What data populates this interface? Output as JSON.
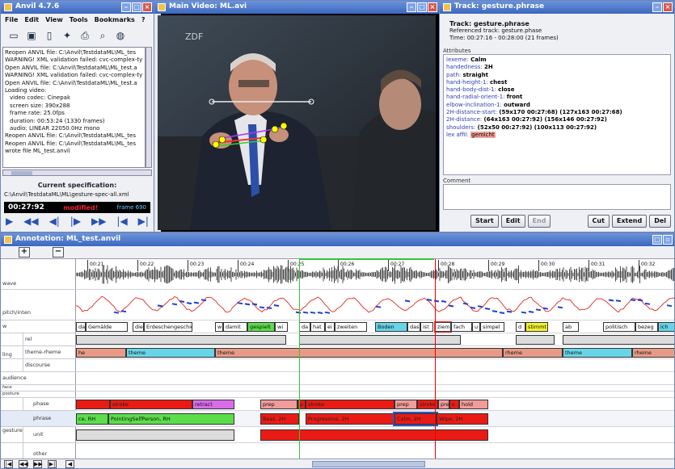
{
  "anvil": {
    "title": "Anvil 4.7.6",
    "menu": [
      "File",
      "Edit",
      "View",
      "Tools",
      "Bookmarks",
      "?"
    ],
    "log": [
      "Reopen ANVIL file: C:\\Anvil\\TestdataML\\ML_tes",
      "WARNING! XML validation failed: cvc-complex-ty",
      "Open ANVIL file: C:\\Anvil\\TestdataML\\ML_test.a",
      "WARNING! XML validation failed: cvc-complex-ty",
      "Open ANVIL file: C:\\Anvil\\TestdataML\\ML_test.a",
      "Loading video:",
      "  video codec: Cinepak",
      "  screen size: 390x288",
      "  frame rate: 25.0fps",
      "  duration: 00:53:24 (1330 frames)",
      "  audio: LINEAR 22050.0Hz mono",
      "Reopen ANVIL file: C:\\Anvil\\TestdataML\\ML_tes",
      "Reopen ANVIL file: C:\\Anvil\\TestdataML\\ML_tes",
      "wrote file ML_test.anvil"
    ],
    "spec_label": "Current specification:",
    "spec_path": "C:\\Anvil\\TestdataML\\ML\\gesture-spec-all.xml",
    "time": "00:27:92",
    "modified": "modified!",
    "frame": "frame 690"
  },
  "video": {
    "title": "Main Video: ML.avi",
    "logo": "ZDF"
  },
  "track": {
    "title": "Track: gesture.phrase",
    "name": "Track: gesture.phrase",
    "ref": "Referenced track: gesture.phase",
    "time": "Time: 00:27:16 - 00:28:00 (21 frames)",
    "attributes_label": "Attributes",
    "attributes": [
      {
        "k": "lexeme:",
        "v": "Calm"
      },
      {
        "k": "handedness:",
        "v": "2H"
      },
      {
        "k": "path:",
        "v": "straight"
      },
      {
        "k": "hand-height-1:",
        "v": "chest"
      },
      {
        "k": "hand-body-dist-1:",
        "v": "close"
      },
      {
        "k": "hand-radial-orient-1:",
        "v": "front"
      },
      {
        "k": "elbow-inclination-1:",
        "v": "outward"
      },
      {
        "k": "2H-distance-start:",
        "v": "(59x170 00:27:68) (127x163 00:27:68)"
      },
      {
        "k": "2H-distance:",
        "v": "(64x163 00:27:92) (156x146 00:27:92)"
      },
      {
        "k": "shoulders:",
        "v": "(52x50 00:27:92) (100x113 00:27:92)"
      }
    ],
    "lex_label": "lex affil:",
    "lex_value": "gemicht",
    "comment_label": "Comment",
    "buttons": {
      "start": "Start",
      "edit": "Edit",
      "end": "End",
      "cut": "Cut",
      "extend": "Extend",
      "del": "Del"
    }
  },
  "annotation": {
    "title": "Annotation: ML_test.anvil",
    "ticks": [
      "00:21",
      "00:22",
      "00:23",
      "00:24",
      "00:25",
      "00:26",
      "00:27",
      "00:28",
      "00:29",
      "00:30",
      "00:31",
      "00:32"
    ],
    "rows": {
      "wave": "wave",
      "pitch": "pitch/inten",
      "w": "w",
      "rel": "rel",
      "ling": "ling",
      "theme": "theme-rheme",
      "discourse": "discourse",
      "audience": "audience",
      "face": "face",
      "posture": "posture",
      "gesture": "gesture",
      "phase": "phase",
      "phrase": "phrase",
      "unit": "unit",
      "other": "other"
    },
    "words": [
      "das",
      "Gemälde",
      "die",
      "Erdeschengeschic",
      "w",
      "damit",
      "gespielt",
      "wi",
      "da",
      "hat",
      "ei",
      "zweiten",
      "Boden",
      "das",
      "ist",
      "ziemi",
      "fach",
      "u",
      "simpel",
      "d",
      "stimmt",
      "ab",
      "politisch",
      "bezeg",
      "ich"
    ],
    "themes": [
      "he",
      "theme",
      "theme",
      "rheme",
      "theme",
      "rheme"
    ],
    "phases": [
      "stroke",
      "retract",
      "prep",
      "p",
      "stroke",
      "prep",
      "stroke",
      "pre",
      "s",
      "hold"
    ],
    "phrases": [
      "ce, RH",
      "PointingSelfPerson, RH",
      "Beat, 2H",
      "Progressive, 2H",
      "Calm, 2H",
      "Wipe, 2H"
    ]
  },
  "colors": {
    "accent": "#3c67c0",
    "stroke": "#ea1b14",
    "phrase": "#5bde4a",
    "word": "#67d5e8",
    "theme": "#e89a86"
  }
}
